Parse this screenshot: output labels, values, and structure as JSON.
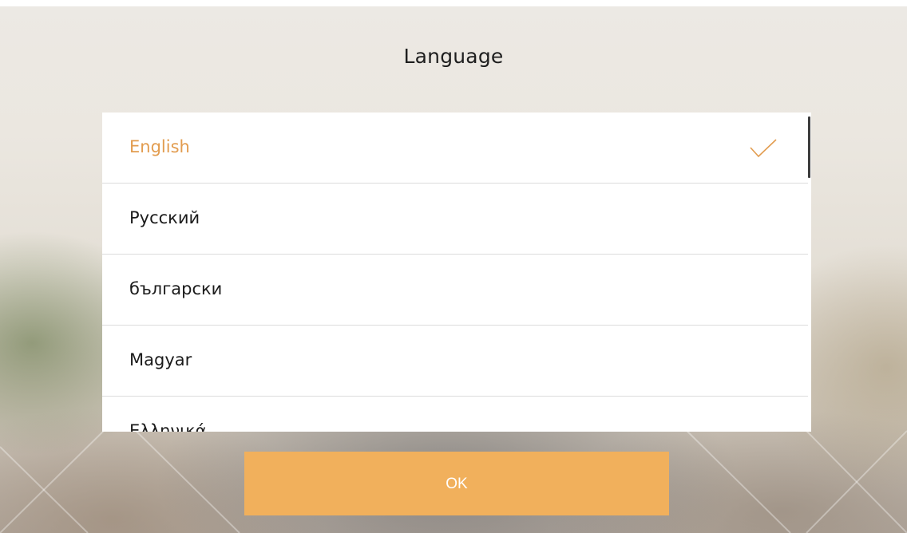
{
  "dialog": {
    "title": "Language"
  },
  "languages": {
    "selected_index": 0,
    "items": [
      {
        "label": "English",
        "selected": true
      },
      {
        "label": "Русский",
        "selected": false
      },
      {
        "label": "български",
        "selected": false
      },
      {
        "label": "Magyar",
        "selected": false
      },
      {
        "label": "Ελληνικά",
        "selected": false
      }
    ]
  },
  "actions": {
    "ok_label": "OK"
  },
  "colors": {
    "accent": "#f1b05c",
    "selected_text": "#e29c4f",
    "text": "#1b1b1b"
  },
  "icons": {
    "selected": "check-icon"
  }
}
